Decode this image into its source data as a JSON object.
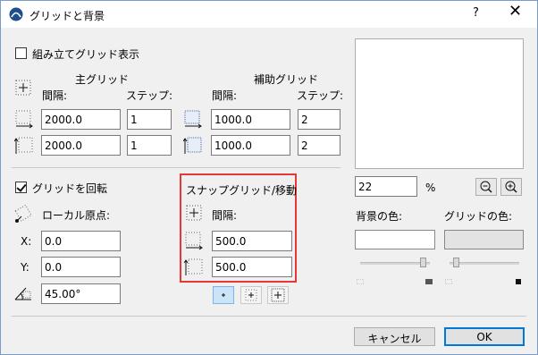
{
  "window": {
    "title": "グリッドと背景",
    "help": "?",
    "close": "✕"
  },
  "construction": {
    "label": "組み立てグリッド表示",
    "checked": false
  },
  "main_grid": {
    "heading": "主グリッド",
    "spacing_label": "間隔:",
    "step_label": "ステップ:",
    "x_spacing": "2000.0",
    "x_step": "1",
    "y_spacing": "2000.0",
    "y_step": "1"
  },
  "aux_grid": {
    "heading": "補助グリッド",
    "spacing_label": "間隔:",
    "step_label": "ステップ:",
    "x_spacing": "1000.0",
    "x_step": "2",
    "y_spacing": "1000.0",
    "y_step": "2"
  },
  "rotate": {
    "label": "グリッドを回転",
    "checked": true,
    "origin_label": "ローカル原点:",
    "x_label": "X:",
    "x_value": "0.0",
    "y_label": "Y:",
    "y_value": "0.0",
    "angle_value": "45.00°"
  },
  "snap": {
    "heading": "スナップグリッド/移動",
    "spacing_label": "間隔:",
    "x_value": "500.0",
    "y_value": "500.0"
  },
  "zoom": {
    "value": "22",
    "unit": "%"
  },
  "colors": {
    "background_label": "背景の色:",
    "grid_label": "グリッドの色:",
    "background_color": "#ffffff",
    "grid_color": "#e3e3e3",
    "background_level": 0.95,
    "grid_level": 0.05
  },
  "buttons": {
    "cancel": "キャンセル",
    "ok": "OK"
  },
  "icons": {
    "app": "archicad-logo-icon",
    "zoom_out": "zoom-out-icon",
    "zoom_in": "zoom-in-icon"
  }
}
